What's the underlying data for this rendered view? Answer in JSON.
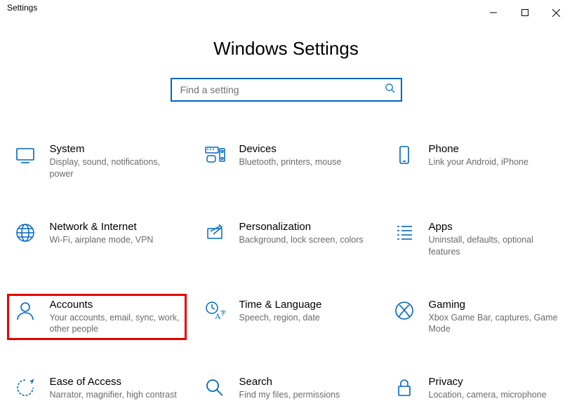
{
  "window": {
    "title": "Settings"
  },
  "header": {
    "title": "Windows Settings"
  },
  "search": {
    "placeholder": "Find a setting"
  },
  "tiles": [
    {
      "title": "System",
      "desc": "Display, sound, notifications, power"
    },
    {
      "title": "Devices",
      "desc": "Bluetooth, printers, mouse"
    },
    {
      "title": "Phone",
      "desc": "Link your Android, iPhone"
    },
    {
      "title": "Network & Internet",
      "desc": "Wi-Fi, airplane mode, VPN"
    },
    {
      "title": "Personalization",
      "desc": "Background, lock screen, colors"
    },
    {
      "title": "Apps",
      "desc": "Uninstall, defaults, optional features"
    },
    {
      "title": "Accounts",
      "desc": "Your accounts, email, sync, work, other people"
    },
    {
      "title": "Time & Language",
      "desc": "Speech, region, date"
    },
    {
      "title": "Gaming",
      "desc": "Xbox Game Bar, captures, Game Mode"
    },
    {
      "title": "Ease of Access",
      "desc": "Narrator, magnifier, high contrast"
    },
    {
      "title": "Search",
      "desc": "Find my files, permissions"
    },
    {
      "title": "Privacy",
      "desc": "Location, camera, microphone"
    }
  ]
}
